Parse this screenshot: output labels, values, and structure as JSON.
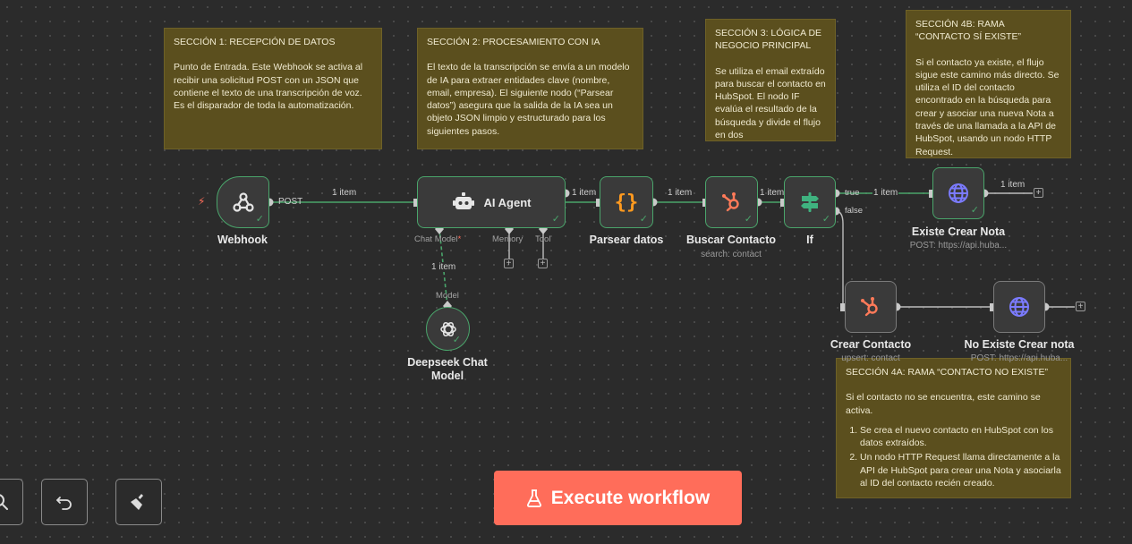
{
  "colors": {
    "success": "#4aa56b",
    "hubspot": "#ff7a59",
    "http": "#7b7bff",
    "code": "#ff9a1f",
    "if": "#3fb27f",
    "execute": "#ff6d5a",
    "sticky": "#5b4f1e"
  },
  "notes": {
    "s1": {
      "title": "SECCIÓN 1: RECEPCIÓN DE DATOS",
      "body": "Punto de Entrada. Este Webhook se activa al recibir una solicitud POST con un JSON que contiene el texto de una transcripción de voz. Es el disparador de toda la automatización."
    },
    "s2": {
      "title": "SECCIÓN 2: PROCESAMIENTO CON IA",
      "body": "El texto de la transcripción se envía a un modelo de IA para extraer entidades clave (nombre, email, empresa). El siguiente nodo (“Parsear datos”) asegura que la salida de la IA sea un objeto JSON limpio y estructurado para los siguientes pasos."
    },
    "s3": {
      "title": "SECCIÓN 3: LÓGICA DE NEGOCIO PRINCIPAL",
      "body": "Se utiliza el email extraído para buscar el contacto en HubSpot. El nodo IF evalúa el resultado de la búsqueda y divide el flujo en dos"
    },
    "s4b": {
      "title": "SECCIÓN 4B: RAMA “CONTACTO SÍ EXISTE”",
      "body": "Si el contacto ya existe, el flujo sigue este camino más directo. Se utiliza el ID del contacto encontrado en la búsqueda para crear y asociar una nueva Nota a través de una llamada a la API de HubSpot, usando un nodo HTTP Request."
    },
    "s4a": {
      "title": "SECCIÓN 4A: RAMA “CONTACTO NO EXISTE”",
      "intro": "Si el contacto no se encuentra, este camino se activa.",
      "items": [
        "Se crea el nuevo contacto en HubSpot con los datos extraídos.",
        "Un nodo HTTP Request llama directamente a la API de HubSpot para crear una Nota y asociarla al ID del contacto recién creado."
      ]
    }
  },
  "nodes": {
    "webhook": {
      "label": "Webhook",
      "out_label": "POST"
    },
    "agent": {
      "label": "AI Agent",
      "ports": [
        "Chat Model",
        "Memory",
        "Tool"
      ],
      "required": "*"
    },
    "parse": {
      "label": "Parsear datos"
    },
    "search": {
      "label": "Buscar Contacto",
      "sub": "search: contact"
    },
    "if": {
      "label": "If",
      "true_label": "true",
      "false_label": "false"
    },
    "exists": {
      "label": "Existe Crear Nota",
      "sub": "POST: https://api.huba..."
    },
    "create": {
      "label": "Crear Contacto",
      "sub": "upsert: contact"
    },
    "noexists": {
      "label": "No Existe Crear nota",
      "sub": "POST: https://api.huba..."
    },
    "deepseek": {
      "label_line1": "Deepseek Chat",
      "label_line2": "Model",
      "port": "Model"
    }
  },
  "edges": {
    "item_label": "1 item"
  },
  "controls": {
    "execute_label": "Execute workflow"
  }
}
